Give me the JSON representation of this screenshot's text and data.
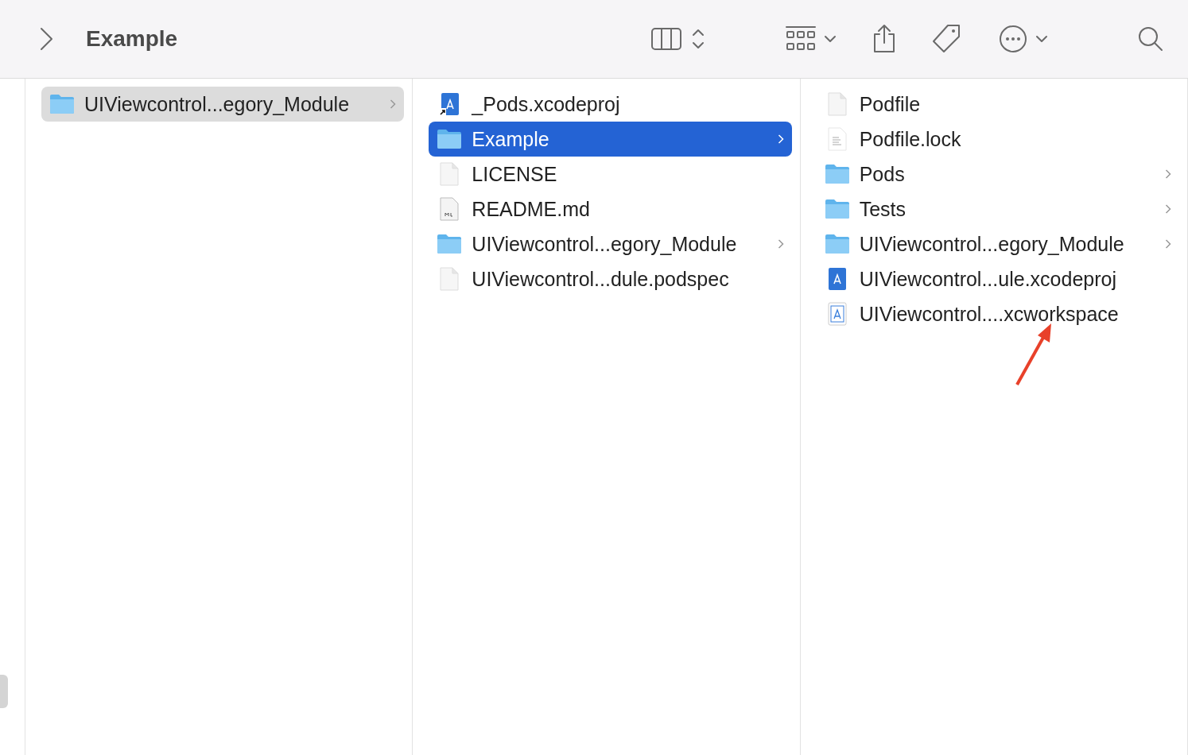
{
  "toolbar": {
    "title": "Example"
  },
  "columns": [
    {
      "focused": false,
      "items": [
        {
          "name": "UIViewcontrol...egory_Module",
          "kind": "folder",
          "has_children": true,
          "selected": true
        }
      ]
    },
    {
      "focused": true,
      "items": [
        {
          "name": "_Pods.xcodeproj",
          "kind": "project-alias",
          "has_children": false,
          "selected": false
        },
        {
          "name": "Example",
          "kind": "folder",
          "has_children": true,
          "selected": true
        },
        {
          "name": "LICENSE",
          "kind": "document",
          "has_children": false,
          "selected": false
        },
        {
          "name": "README.md",
          "kind": "markdown",
          "has_children": false,
          "selected": false
        },
        {
          "name": "UIViewcontrol...egory_Module",
          "kind": "folder",
          "has_children": true,
          "selected": false
        },
        {
          "name": "UIViewcontrol...dule.podspec",
          "kind": "document",
          "has_children": false,
          "selected": false
        }
      ]
    },
    {
      "items": [
        {
          "name": "Podfile",
          "kind": "document",
          "has_children": false,
          "selected": false
        },
        {
          "name": "Podfile.lock",
          "kind": "text",
          "has_children": false,
          "selected": false
        },
        {
          "name": "Pods",
          "kind": "folder",
          "has_children": true,
          "selected": false
        },
        {
          "name": "Tests",
          "kind": "folder",
          "has_children": true,
          "selected": false
        },
        {
          "name": "UIViewcontrol...egory_Module",
          "kind": "folder",
          "has_children": true,
          "selected": false
        },
        {
          "name": "UIViewcontrol...ule.xcodeproj",
          "kind": "project",
          "has_children": false,
          "selected": false
        },
        {
          "name": "UIViewcontrol....xcworkspace",
          "kind": "workspace",
          "has_children": false,
          "selected": false
        }
      ]
    }
  ]
}
